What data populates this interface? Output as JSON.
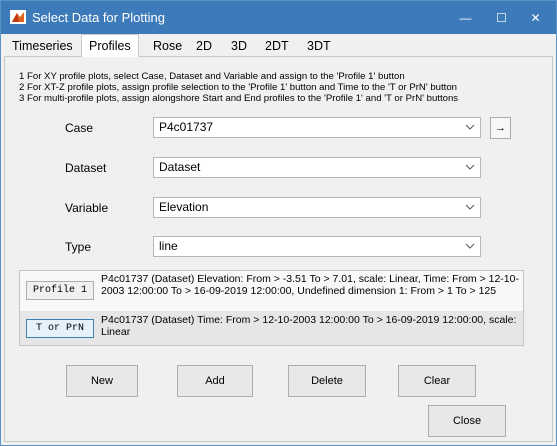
{
  "window": {
    "title": "Select Data for Plotting",
    "min_glyph": "—",
    "max_glyph": "☐",
    "close_glyph": "✕"
  },
  "tabs": [
    {
      "label": "Timeseries",
      "active": false
    },
    {
      "label": "Profiles",
      "active": true
    },
    {
      "label": "Rose",
      "active": false
    },
    {
      "label": "2D",
      "active": false
    },
    {
      "label": "3D",
      "active": false
    },
    {
      "label": "2DT",
      "active": false
    },
    {
      "label": "3DT",
      "active": false
    }
  ],
  "instructions": [
    "1 For XY profile plots, select  Case, Dataset and Variable and assign to the 'Profile 1' button",
    "2 For XT-Z profile plots, assign profile selection to the 'Profile 1' button and Time to the 'T or PrN' button",
    "3 For multi-profile plots, assign alongshore Start and End profiles to the 'Profile 1' and 'T or PrN' buttons"
  ],
  "fields": {
    "case": {
      "label": "Case",
      "value": "P4c01737"
    },
    "dataset": {
      "label": "Dataset",
      "value": "Dataset"
    },
    "variable": {
      "label": "Variable",
      "value": "Elevation"
    },
    "type": {
      "label": "Type",
      "value": "line"
    }
  },
  "assign_button_glyph": "→",
  "selection": {
    "profile1": {
      "button": "Profile 1",
      "text": "P4c01737 (Dataset) Elevation: From > -3.51 To > 7.01, scale: Linear, Time: From > 12-10-2003 12:00:00 To > 16-09-2019 12:00:00, Undefined dimension 1: From > 1 To > 125"
    },
    "torprn": {
      "button": "T or PrN",
      "text": "P4c01737 (Dataset) Time: From > 12-10-2003 12:00:00 To > 16-09-2019 12:00:00, scale: Linear"
    }
  },
  "buttons": {
    "new": "New",
    "add": "Add",
    "delete": "Delete",
    "clear": "Clear",
    "close": "Close"
  },
  "colors": {
    "titlebar": "#3d7ab9",
    "panel": "#f0f0f0"
  }
}
